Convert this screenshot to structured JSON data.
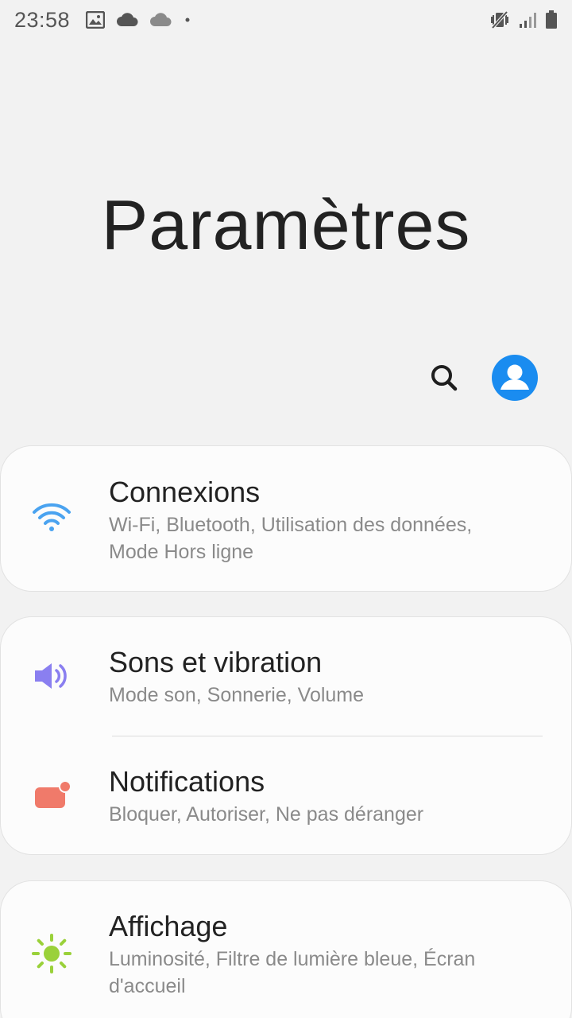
{
  "status_bar": {
    "time": "23:58",
    "left_icons": [
      "image-icon",
      "cloud-icon",
      "cloud-outline-icon",
      "dot-icon"
    ],
    "right_icons": [
      "vibrate-mute-icon",
      "signal-icon",
      "battery-icon"
    ]
  },
  "page": {
    "title": "Paramètres"
  },
  "header_actions": {
    "search_icon": "search-icon",
    "account_icon": "account-icon"
  },
  "colors": {
    "background": "#f2f2f2",
    "card": "#fcfcfc",
    "wifi": "#4aa3f0",
    "sound": "#8a7ff0",
    "notifications": "#f07a6a",
    "display": "#9ad13a",
    "avatar": "#1a8cf0"
  },
  "settings": [
    {
      "icon": "wifi-icon",
      "title": "Connexions",
      "subtitle_line1": "Wi-Fi, Bluetooth, Utilisation des données,",
      "subtitle_line2": "Mode Hors ligne"
    },
    {
      "icon": "volume-icon",
      "title": "Sons et vibration",
      "subtitle_line1": "Mode son, Sonnerie, Volume"
    },
    {
      "icon": "notification-icon",
      "title": "Notifications",
      "subtitle_line1": "Bloquer, Autoriser, Ne pas déranger"
    },
    {
      "icon": "brightness-icon",
      "title": "Affichage",
      "subtitle_line1": "Luminosité, Filtre de lumière bleue, Écran",
      "subtitle_line2": "d'accueil"
    }
  ]
}
